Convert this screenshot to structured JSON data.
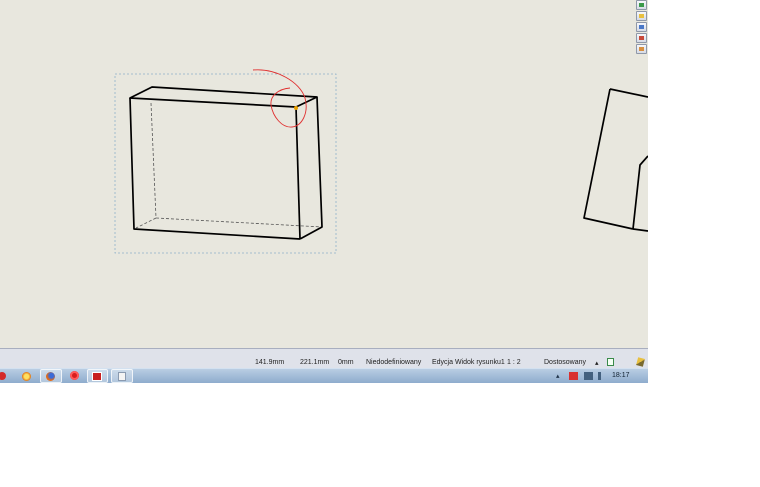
{
  "status_bar": {
    "x_coordinate": "141.9mm",
    "y_coordinate": "221.1mm",
    "z_coordinate": "0mm",
    "constraint_state": "Niedodefiniowany",
    "edit_mode": "Edycja Widok rysunku1",
    "scale": "1 : 2",
    "units": "Dostosowany",
    "units_dropdown_arrow": "▴"
  },
  "taskbar": {
    "tray_arrow": "▴",
    "clock": "18:17",
    "apps": [
      "solidworks-icon",
      "settings-icon",
      "firefox-icon",
      "opera-icon",
      "solidworks-drawing-icon",
      "notepad-icon"
    ]
  },
  "side_toolbar": {
    "icons": [
      "view-palette-icon",
      "folder-icon",
      "appearances-icon",
      "design-library-icon",
      "custom-properties-icon"
    ]
  },
  "colors": {
    "canvas_background": "#e8e7de",
    "model_edges": "#000000",
    "hidden_edges": "#555555",
    "selection_box": "#8fb1c9",
    "annotation_circle": "#e03030",
    "statusbar_background": "#dfe2ea",
    "taskbar_background": "#a3bcd9"
  }
}
